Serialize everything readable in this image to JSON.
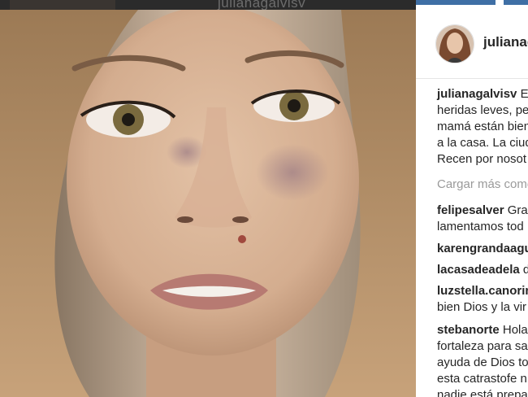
{
  "overlay": {
    "handle": "julianagalvisv"
  },
  "post": {
    "username": "julianagalv",
    "caption_user": "julianagalvisv",
    "caption_lines": [
      "Es",
      "heridas leves, pe",
      "mamá están bien",
      "a la casa. La ciud",
      "Recen por nosot"
    ]
  },
  "load_more": "Cargar más come",
  "comments": [
    {
      "user": "felipesalver",
      "lines": [
        "Grac",
        "lamentamos tod"
      ]
    },
    {
      "user": "karengrandaagu",
      "lines": [
        ""
      ]
    },
    {
      "user": "lacasadeadela",
      "lines": [
        "d"
      ]
    },
    {
      "user": "luzstella.canorin",
      "lines": [
        "",
        "bien Dios y la vir"
      ]
    },
    {
      "user": "stebanorte",
      "lines": [
        "Hola",
        "fortaleza para sa",
        "ayuda de Dios to",
        "esta catrastofe n",
        "nadie está prepa"
      ]
    }
  ],
  "colors": {
    "accent": "#3f6fa5",
    "text": "#262626",
    "muted": "#9a9a9a"
  }
}
